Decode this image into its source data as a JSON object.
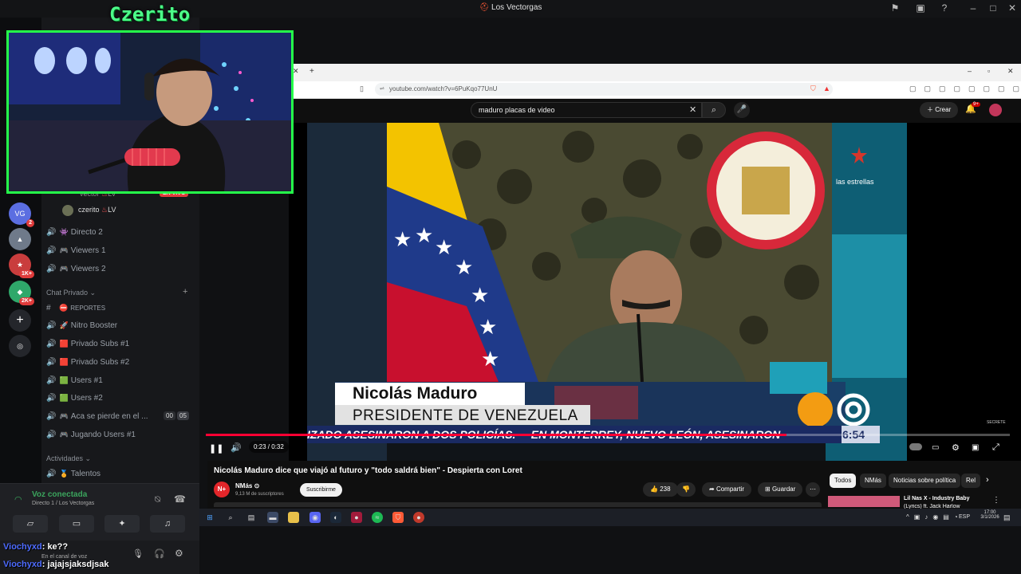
{
  "window": {
    "title": "Los Vectorgas"
  },
  "overlay": {
    "streamer_name": "Czerito"
  },
  "discord": {
    "live_badge": "EN VIVO",
    "voice_members": [
      {
        "name": "czerito",
        "tag": "LV"
      },
      {
        "name": "vector",
        "tag": "LV"
      }
    ],
    "channels_top": [
      {
        "name": "Directo 2",
        "emoji": "👾"
      },
      {
        "name": "Viewers 1",
        "emoji": "🎮"
      },
      {
        "name": "Viewers 2",
        "emoji": "🎮"
      }
    ],
    "category_private": "Chat Privado",
    "private_channels": [
      {
        "name": "REPORTES",
        "emoji": "⛔",
        "type": "text"
      },
      {
        "name": "Nitro Booster",
        "emoji": "🚀",
        "type": "voice"
      },
      {
        "name": "Privado Subs #1",
        "emoji": "🟥",
        "type": "voice"
      },
      {
        "name": "Privado Subs #2",
        "emoji": "🟥",
        "type": "voice"
      },
      {
        "name": "Users #1",
        "emoji": "🟩",
        "type": "voice"
      },
      {
        "name": "Users #2",
        "emoji": "🟩",
        "type": "voice"
      },
      {
        "name": "Aca se pierde en el ...",
        "emoji": "🎮",
        "type": "voice",
        "count_a": "00",
        "count_b": "05"
      },
      {
        "name": "Jugando Users #1",
        "emoji": "🎮",
        "type": "voice"
      }
    ],
    "category_activities": "Actividades",
    "activities": [
      {
        "name": "Talentos",
        "emoji": "🏅"
      }
    ],
    "rail_badges": [
      "2",
      "1K+",
      "2K+"
    ],
    "voice_panel": {
      "status": "Voz conectada",
      "channel": "Directo 1 / Los Vectorgas"
    },
    "user_panel": {
      "status": "En el canal de voz"
    }
  },
  "chat": [
    {
      "user": "Viochyxd",
      "message": ": ke??"
    },
    {
      "user": "Viochyxd",
      "message": ": jajajsjaksdjsak"
    }
  ],
  "browser": {
    "url": "youtube.com/watch?v=6PuKqo77UnU"
  },
  "youtube": {
    "search_query": "maduro placas de video",
    "create_label": "Crear",
    "notif_count": "9+",
    "time": "0:23 / 0:32",
    "video_title": "Nicolás Maduro dice que viajó al futuro y \"todo saldrá bien\" - Despierta con Loret",
    "channel": "NMás",
    "subscribers": "9,13 M de suscriptores",
    "subscribe": "Suscribirme",
    "likes": "238",
    "share": "Compartir",
    "save": "Guardar",
    "chips": [
      "Todos",
      "NMás",
      "Noticias sobre política",
      "Rel"
    ],
    "rec_title": "Lil Nas X - Industry Baby",
    "rec_sub": "(Lyrics) ft. Jack Harlow"
  },
  "video_overlay": {
    "name": "Nicolás Maduro",
    "role": "PRESIDENTE DE VENEZUELA",
    "ticker": "IZADO ASESINARON A DOS POLICÍAS.     EN MONTERREY, NUEVO LEÓN, ASESINARON",
    "clock": "6:54",
    "network": "las estrellas",
    "corner": "SECRETE"
  },
  "taskbar": {
    "lang": "ESP",
    "time": "17:00",
    "date": "3/1/2026"
  },
  "colors": {
    "overlay_green": "#25ff4a",
    "youtube_red": "#ff0033",
    "discord_bg": "#17181b"
  }
}
